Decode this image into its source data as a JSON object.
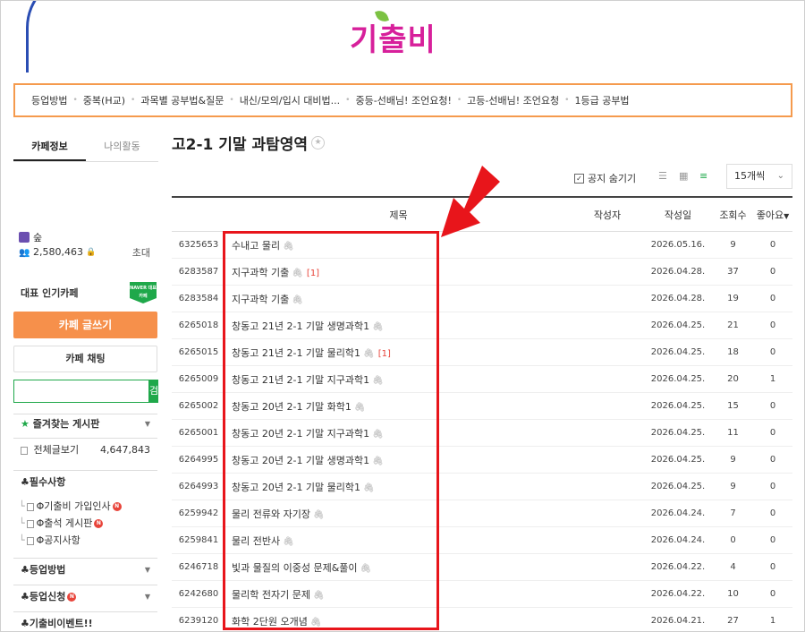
{
  "header": {
    "logo_text": "기출비"
  },
  "menu": [
    "등업방법",
    "중복(H교)",
    "과목별 공부법&질문",
    "내신/모의/입시 대비법...",
    "중등-선배님! 조언요청!",
    "고등-선배님! 조언요청",
    "1등급 공부법"
  ],
  "sidebar": {
    "tab_info": "카페정보",
    "tab_activity": "나의활동",
    "level": "숲",
    "members": "2,580,463",
    "invite": "초대",
    "popular_label": "대표 인기카페",
    "naver_badge": "NAVER 대표카페",
    "write_button": "카페 글쓰기",
    "chat_button": "카페 채팅",
    "search_button": "검색",
    "favorites": "즐겨찾는 게시판",
    "all_posts": "전체글보기",
    "all_posts_count": "4,647,843",
    "required": "♣필수사항",
    "sub1": "Φ기출비 가입인사",
    "sub2": "Φ출석 게시판",
    "sub3": "Φ공지사항",
    "levelup": "♣등업방법",
    "levelup_apply": "♣등업신청",
    "event": "♣기출비이벤트!!",
    "new_badge": "N"
  },
  "board": {
    "title": "고2-1 기말 과탐영역",
    "notice_hide": "공지 숨기기",
    "per_page": "15개씩",
    "headers": {
      "title": "제목",
      "author": "작성자",
      "date": "작성일",
      "views": "조회수",
      "likes": "좋아요"
    }
  },
  "rows": [
    {
      "num": "6325653",
      "title": "수내고 물리",
      "comments": "",
      "date": "2026.05.16.",
      "views": "9",
      "likes": "0"
    },
    {
      "num": "6283587",
      "title": "지구과학 기출",
      "comments": "[1]",
      "date": "2026.04.28.",
      "views": "37",
      "likes": "0"
    },
    {
      "num": "6283584",
      "title": "지구과학 기출",
      "comments": "",
      "date": "2026.04.28.",
      "views": "19",
      "likes": "0"
    },
    {
      "num": "6265018",
      "title": "창동고 21년 2-1 기말 생명과학1",
      "comments": "",
      "date": "2026.04.25.",
      "views": "21",
      "likes": "0"
    },
    {
      "num": "6265015",
      "title": "창동고 21년 2-1 기말 물리학1",
      "comments": "[1]",
      "date": "2026.04.25.",
      "views": "18",
      "likes": "0"
    },
    {
      "num": "6265009",
      "title": "창동고 21년 2-1 기말 지구과학1",
      "comments": "",
      "date": "2026.04.25.",
      "views": "20",
      "likes": "1"
    },
    {
      "num": "6265002",
      "title": "창동고 20년 2-1 기말 화학1",
      "comments": "",
      "date": "2026.04.25.",
      "views": "15",
      "likes": "0"
    },
    {
      "num": "6265001",
      "title": "창동고 20년 2-1 기말 지구과학1",
      "comments": "",
      "date": "2026.04.25.",
      "views": "11",
      "likes": "0"
    },
    {
      "num": "6264995",
      "title": "창동고 20년 2-1 기말 생명과학1",
      "comments": "",
      "date": "2026.04.25.",
      "views": "9",
      "likes": "0"
    },
    {
      "num": "6264993",
      "title": "창동고 20년 2-1 기말 물리학1",
      "comments": "",
      "date": "2026.04.25.",
      "views": "9",
      "likes": "0"
    },
    {
      "num": "6259942",
      "title": "물리 전류와 자기장",
      "comments": "",
      "date": "2026.04.24.",
      "views": "7",
      "likes": "0"
    },
    {
      "num": "6259841",
      "title": "물리 전반사",
      "comments": "",
      "date": "2026.04.24.",
      "views": "0",
      "likes": "0"
    },
    {
      "num": "6246718",
      "title": "빛과 물질의 이중성 문제&풀이",
      "comments": "",
      "date": "2026.04.22.",
      "views": "4",
      "likes": "0"
    },
    {
      "num": "6242680",
      "title": "물리학 전자기 문제",
      "comments": "",
      "date": "2026.04.22.",
      "views": "10",
      "likes": "0"
    },
    {
      "num": "6239120",
      "title": "화학 2단원 오개념",
      "comments": "",
      "date": "2026.04.21.",
      "views": "27",
      "likes": "1"
    }
  ]
}
